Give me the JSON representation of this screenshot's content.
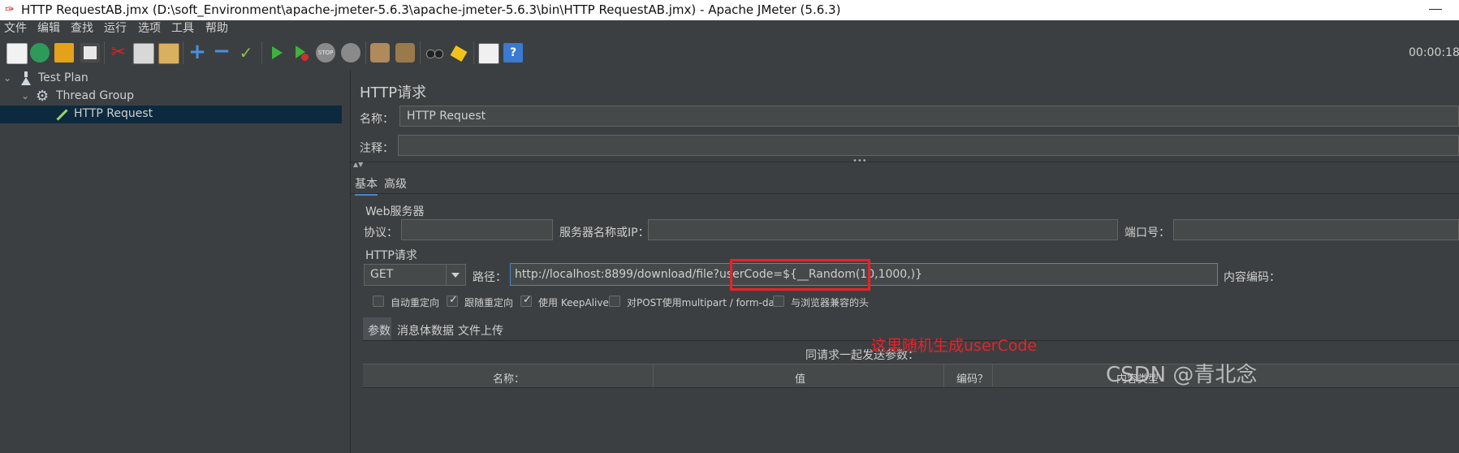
{
  "window": {
    "title": "HTTP RequestAB.jmx (D:\\soft_Environment\\apache-jmeter-5.6.3\\apache-jmeter-5.6.3\\bin\\HTTP RequestAB.jmx) - Apache JMeter (5.6.3)"
  },
  "menu": [
    "文件",
    "编辑",
    "查找",
    "运行",
    "选项",
    "工具",
    "帮助"
  ],
  "toolbar": {
    "timer": "00:00:18",
    "buttons": [
      "new-icon",
      "templates-icon",
      "open-icon",
      "save-icon",
      "cut-icon",
      "copy-icon",
      "paste-icon",
      "expand-icon",
      "collapse-icon",
      "toggle-icon",
      "start-icon",
      "start-no-pause-icon",
      "stop-icon",
      "shutdown-icon",
      "clear-icon",
      "clear-all-icon",
      "search-icon",
      "reset-search-icon",
      "function-helper-icon",
      "help-icon"
    ],
    "stop_label": "STOP"
  },
  "tree": [
    {
      "label": "Test Plan",
      "icon": "flask-icon"
    },
    {
      "label": "Thread Group",
      "icon": "gear-icon"
    },
    {
      "label": "HTTP Request",
      "icon": "pipette-icon",
      "selected": true
    }
  ],
  "panel": {
    "title": "HTTP请求",
    "name_label": "名称：",
    "name_value": "HTTP Request",
    "comment_label": "注释：",
    "comment_value": "",
    "tabs": [
      "基本",
      "高级"
    ],
    "web_server_group": "Web服务器",
    "protocol_label": "协议：",
    "server_label": "服务器名称或IP：",
    "port_label": "端口号：",
    "http_group": "HTTP请求",
    "method": "GET",
    "path_label": "路径：",
    "path_value": "http://localhost:8899/download/file?userCode=${__Random(10,1000,)}",
    "encoding_label": "内容编码：",
    "options": [
      {
        "label": "自动重定向",
        "checked": false
      },
      {
        "label": "跟随重定向",
        "checked": true
      },
      {
        "label": "使用 KeepAlive",
        "checked": true
      },
      {
        "label": "对POST使用multipart / form-data",
        "checked": false
      },
      {
        "label": "与浏览器兼容的头",
        "checked": false
      }
    ],
    "sub_tabs": [
      "参数",
      "消息体数据",
      "文件上传"
    ],
    "params_caption": "同请求一起发送参数：",
    "columns": [
      "名称：",
      "值",
      "编码？",
      "内容类型"
    ]
  },
  "annotation": {
    "text": "这里随机生成userCode",
    "color": "#e8232a"
  },
  "watermark": "CSDN @青北念"
}
